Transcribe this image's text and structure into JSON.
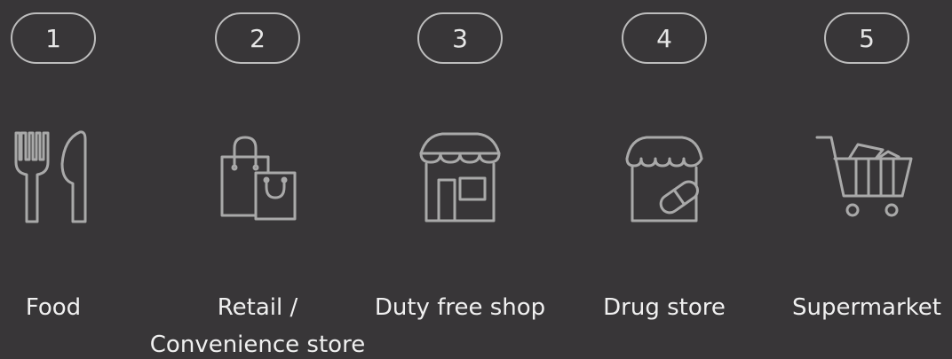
{
  "steps": [
    {
      "number": "1",
      "label_lines": [
        "Food"
      ],
      "icon": "fork-knife-icon"
    },
    {
      "number": "2",
      "label_lines": [
        "Retail /",
        "Convenience store"
      ],
      "icon": "shopping-bags-icon"
    },
    {
      "number": "3",
      "label_lines": [
        "Duty free shop"
      ],
      "icon": "storefront-icon"
    },
    {
      "number": "4",
      "label_lines": [
        "Drug store"
      ],
      "icon": "pharmacy-store-pill-icon"
    },
    {
      "number": "5",
      "label_lines": [
        "Supermarket"
      ],
      "icon": "shopping-cart-icon"
    }
  ],
  "colors": {
    "background": "#383638",
    "icon_stroke": "#a9a9a9",
    "badge_border": "#bdbdbd",
    "text": "#f0f0f0"
  }
}
